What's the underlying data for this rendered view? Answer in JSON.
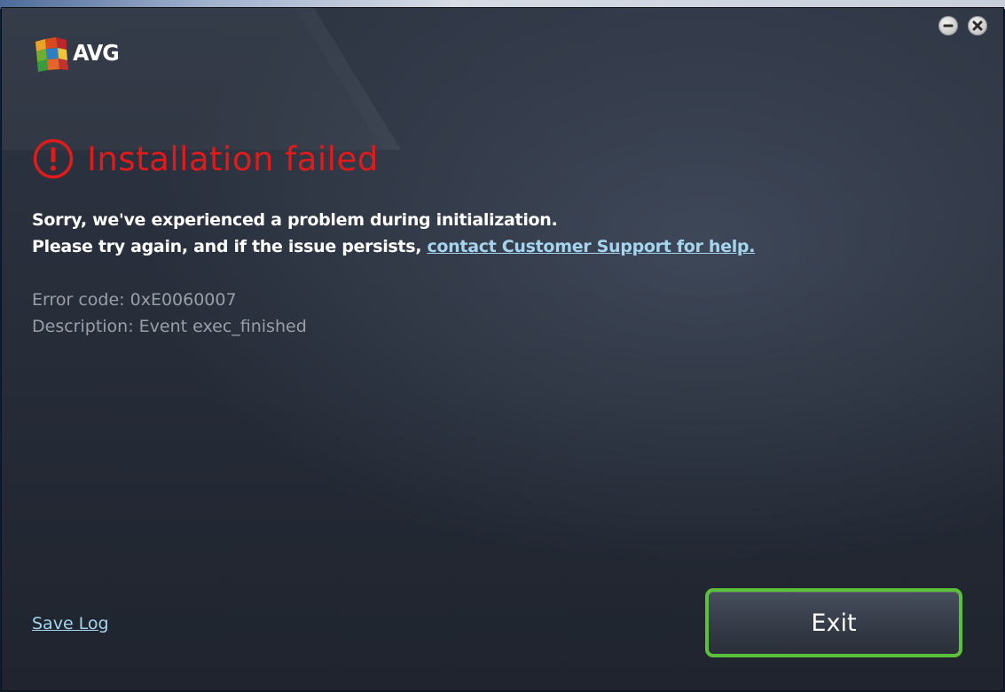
{
  "window": {
    "brand": "AVG",
    "controls": [
      "minimize-icon",
      "close-icon"
    ]
  },
  "error": {
    "title": "Installation failed",
    "icon": "exclamation-circle-icon",
    "line1": "Sorry, we've experienced a problem during initialization.",
    "line2_prefix": "Please try again, and if the issue persists, ",
    "support_link": "contact Customer Support for help.",
    "code_label": "Error code: 0xE0060007",
    "description_label": "Description: Event exec_finished"
  },
  "footer": {
    "save_log": "Save Log",
    "exit_label": "Exit"
  },
  "colors": {
    "error_red": "#e11a1a",
    "link_blue": "#a5d4ee",
    "exit_border_green": "#5cc13a",
    "detail_gray": "#9b9fa6"
  }
}
